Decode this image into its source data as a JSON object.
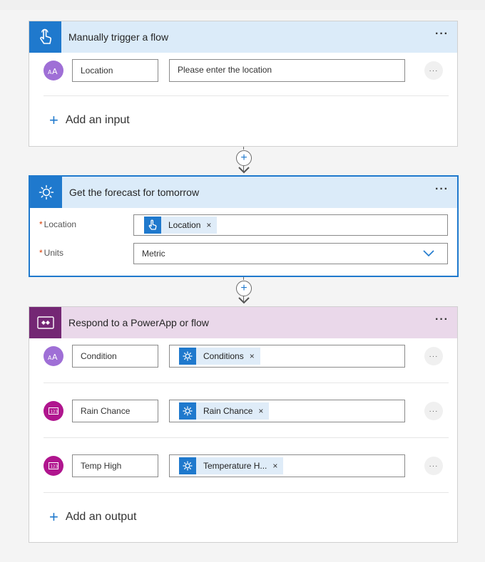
{
  "trigger_card": {
    "title": "Manually trigger a flow",
    "more_label": "···",
    "input": {
      "name": "Location",
      "placeholder": "Please enter the location",
      "more_label": "···"
    },
    "add_label": "Add an input",
    "header_color": "#dbebf9",
    "icon_bg": "#1f79cd",
    "icon": "hand-pointer-icon"
  },
  "connector_plus": "+",
  "forecast_card": {
    "title": "Get the forecast for tomorrow",
    "more_label": "···",
    "fields": [
      {
        "label": "Location",
        "required_mark": "*",
        "token": {
          "label": "Location",
          "close": "×",
          "icon": "hand-pointer-icon"
        }
      },
      {
        "label": "Units",
        "required_mark": "*",
        "value": "Metric",
        "icon": "chevron-down-icon"
      }
    ],
    "header_color": "#dbebf9",
    "icon_bg": "#1f79cd",
    "icon": "sun-icon"
  },
  "respond_card": {
    "title": "Respond to a PowerApp or flow",
    "more_label": "···",
    "outputs": [
      {
        "name": "Condition",
        "token": "Conditions",
        "type": "text",
        "more_label": "···"
      },
      {
        "name": "Rain Chance",
        "token": "Rain Chance",
        "type": "number",
        "more_label": "···"
      },
      {
        "name": "Temp High",
        "token": "Temperature H...",
        "type": "number",
        "more_label": "···"
      }
    ],
    "token_close": "×",
    "add_label": "Add an output",
    "header_color": "#ead8ea",
    "icon_bg": "#742774",
    "icon": "powerapps-icon"
  }
}
